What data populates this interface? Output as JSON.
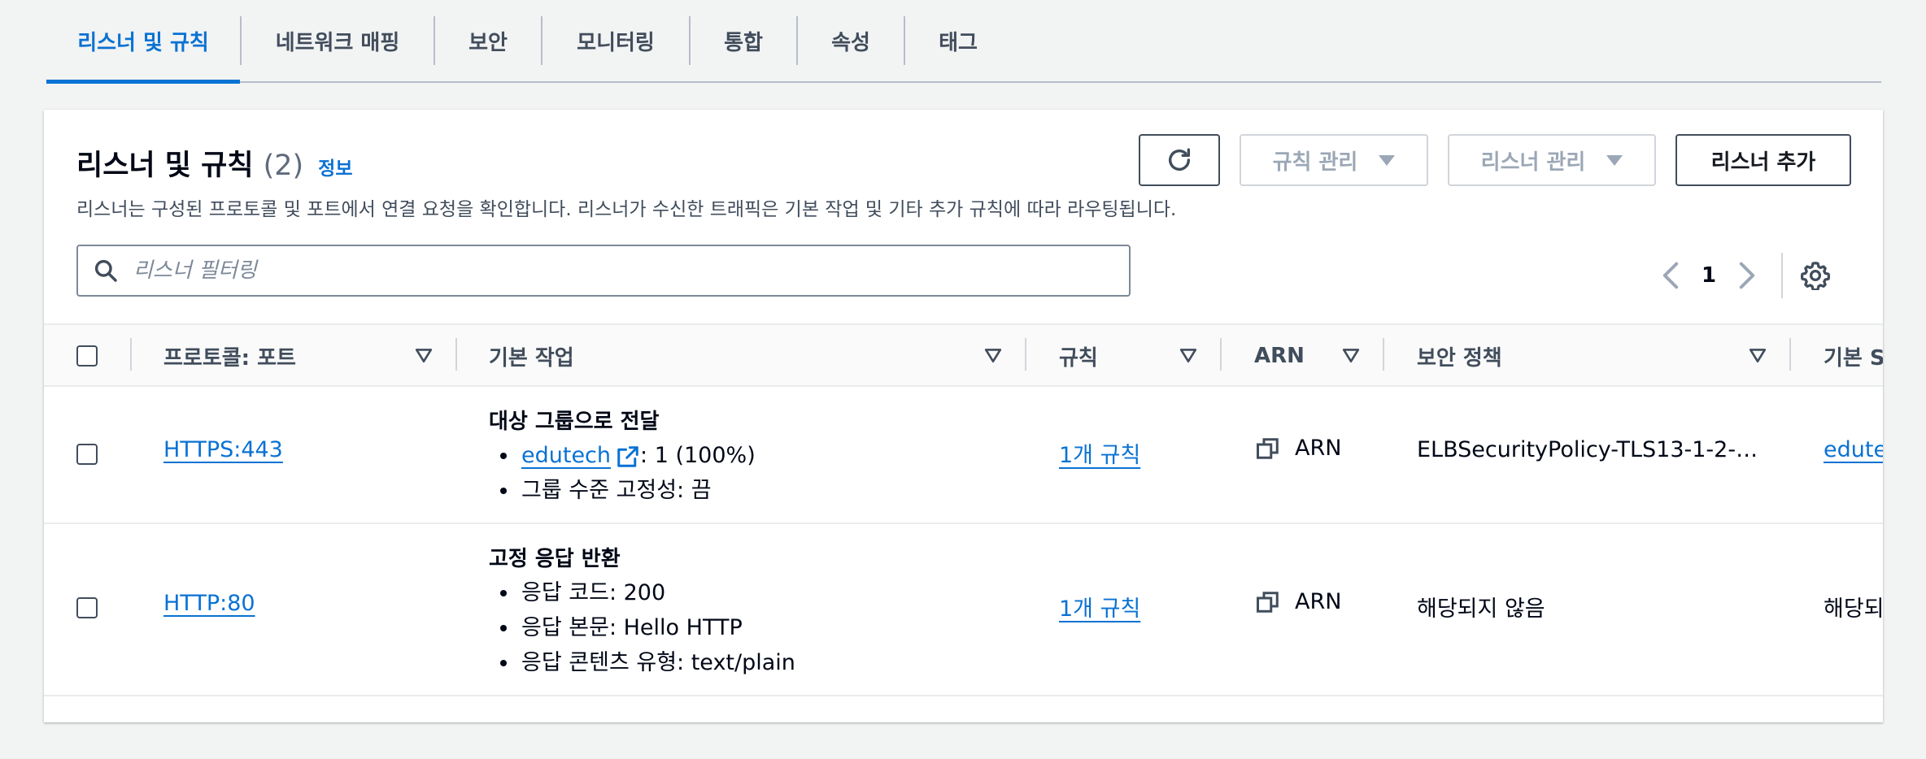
{
  "tabs": [
    {
      "label": "리스너 및 규칙",
      "active": true
    },
    {
      "label": "네트워크 매핑"
    },
    {
      "label": "보안"
    },
    {
      "label": "모니터링"
    },
    {
      "label": "통합"
    },
    {
      "label": "속성"
    },
    {
      "label": "태그"
    }
  ],
  "panel": {
    "title": "리스너 및 규칙",
    "count": "(2)",
    "info": "정보",
    "description": "리스너는 구성된 프로토콜 및 포트에서 연결 요청을 확인합니다. 리스너가 수신한 트래픽은 기본 작업 및 기타 추가 규칙에 따라 라우팅됩니다."
  },
  "actions": {
    "refresh_icon": "refresh-icon",
    "manage_rules": "규칙 관리",
    "manage_listeners": "리스너 관리",
    "add_listener": "리스너 추가"
  },
  "search": {
    "placeholder": "리스너 필터링",
    "value": ""
  },
  "pagination": {
    "current_page": "1"
  },
  "table": {
    "headers": {
      "protocol_port": "프로토콜: 포트",
      "default_action": "기본 작업",
      "rules": "규칙",
      "arn": "ARN",
      "security_policy": "보안 정책",
      "default_ssl": "기본 S"
    },
    "rows": [
      {
        "protocol_port": "HTTPS:443",
        "action_title": "대상 그룹으로 전달",
        "target_group": "edutech",
        "target_weight": ": 1 (100%)",
        "stickiness": "그룹 수준 고정성: 끔",
        "rules": "1개 규칙",
        "arn": "ARN",
        "security_policy": "ELBSecurityPolicy-TLS13-1-2-…",
        "default_ssl": "edute"
      },
      {
        "protocol_port": "HTTP:80",
        "action_title": "고정 응답 반환",
        "response_code": "응답 코드: 200",
        "response_body": "응답 본문: Hello HTTP",
        "content_type": "응답 콘텐츠 유형: text/plain",
        "rules": "1개 규칙",
        "arn": "ARN",
        "security_policy": "해당되지 않음",
        "default_ssl": "해당되"
      }
    ]
  },
  "colors": {
    "accent": "#0972d3",
    "text": "#000716",
    "muted": "#414d5c",
    "disabled": "#9ba7b6",
    "background": "#f2f3f3"
  }
}
